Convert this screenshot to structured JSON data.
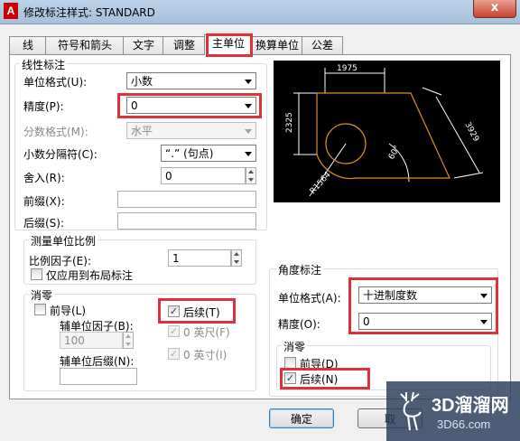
{
  "window": {
    "title": "修改标注样式: STANDARD",
    "app_letter": "A",
    "close_glyph": "x"
  },
  "tabs": [
    {
      "label": "线"
    },
    {
      "label": "符号和箭头"
    },
    {
      "label": "文字"
    },
    {
      "label": "调整"
    },
    {
      "label": "主单位",
      "active": true
    },
    {
      "label": "换算单位"
    },
    {
      "label": "公差"
    }
  ],
  "linear": {
    "title": "线性标注",
    "unit_format_label": "单位格式(U):",
    "unit_format_value": "小数",
    "precision_label": "精度(P):",
    "precision_value": "0",
    "fraction_label": "分数格式(M):",
    "fraction_value": "水平",
    "decimal_sep_label": "小数分隔符(C):",
    "decimal_sep_value": "“.” (句点)",
    "round_label": "舍入(R):",
    "round_value": "0",
    "prefix_label": "前缀(X):",
    "prefix_value": "",
    "suffix_label": "后缀(S):",
    "suffix_value": ""
  },
  "scale": {
    "title": "测量单位比例",
    "factor_label": "比例因子(E):",
    "factor_value": "1",
    "layout_only_label": "仅应用到布局标注"
  },
  "zero": {
    "title": "消零",
    "leading_label": "前导(L)",
    "sub_factor_label": "辅单位因子(B):",
    "sub_factor_value": "100",
    "sub_suffix_label": "辅单位后缀(N):",
    "sub_suffix_value": "",
    "trailing_label": "后续(T)",
    "feet_label": "0 英尺(F)",
    "inch_label": "0 英寸(I)"
  },
  "angular": {
    "title": "角度标注",
    "unit_format_label": "单位格式(A):",
    "unit_format_value": "十进制度数",
    "precision_label": "精度(O):",
    "precision_value": "0",
    "zero_title": "消零",
    "leading_label": "前导(D)",
    "trailing_label": "后续(N)"
  },
  "preview": {
    "dim_top": "1975",
    "dim_left": "2325",
    "dim_right": "3929",
    "dim_angle": "60°",
    "dim_radius": "R1564",
    "line_color": "#d8902a",
    "dim_color": "#ffffff"
  },
  "buttons": {
    "ok": "确定",
    "cancel": "取"
  },
  "watermark": {
    "brand": "3D溜溜网",
    "url": "3D66.com"
  },
  "colors": {
    "highlight": "#e0303a"
  }
}
